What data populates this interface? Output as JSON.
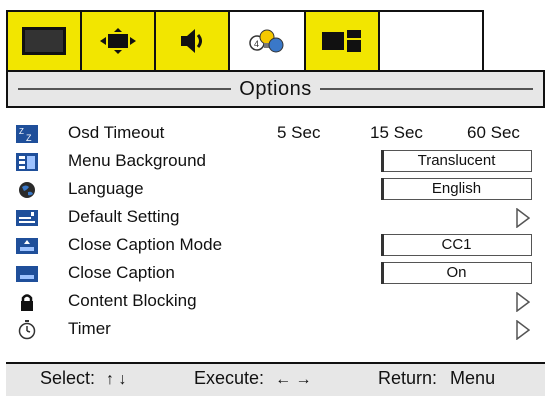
{
  "tabs": [
    {
      "icon": "monitor-icon",
      "active": false
    },
    {
      "icon": "screen-adjust-icon",
      "active": false
    },
    {
      "icon": "speaker-icon",
      "active": false
    },
    {
      "icon": "options-icon",
      "active": true
    },
    {
      "icon": "pip-icon",
      "active": false
    }
  ],
  "header": {
    "title": "Options"
  },
  "rows": [
    {
      "icon": "zz-sleep-icon",
      "label": "Osd Timeout",
      "options": [
        "5 Sec",
        "15 Sec",
        "60 Sec"
      ]
    },
    {
      "icon": "menu-background-icon",
      "label": "Menu Background",
      "value": "Translucent"
    },
    {
      "icon": "globe-icon",
      "label": "Language",
      "value": "English"
    },
    {
      "icon": "default-setting-icon",
      "label": "Default Setting",
      "arrow": true
    },
    {
      "icon": "close-caption-mode-icon",
      "label": "Close Caption Mode",
      "value": "CC1"
    },
    {
      "icon": "close-caption-icon",
      "label": "Close Caption",
      "value": "On"
    },
    {
      "icon": "lock-icon",
      "label": "Content Blocking",
      "arrow": true
    },
    {
      "icon": "timer-icon",
      "label": "Timer",
      "arrow": true
    }
  ],
  "footer": {
    "select_label": "Select:",
    "select_arrows": "↑ ↓",
    "execute_label": "Execute:",
    "execute_arrows": "← →",
    "return_label": "Return:",
    "return_key": "Menu"
  },
  "colors": {
    "tab_yellow": "#f2e600",
    "header_gray": "#e7e7e7"
  }
}
